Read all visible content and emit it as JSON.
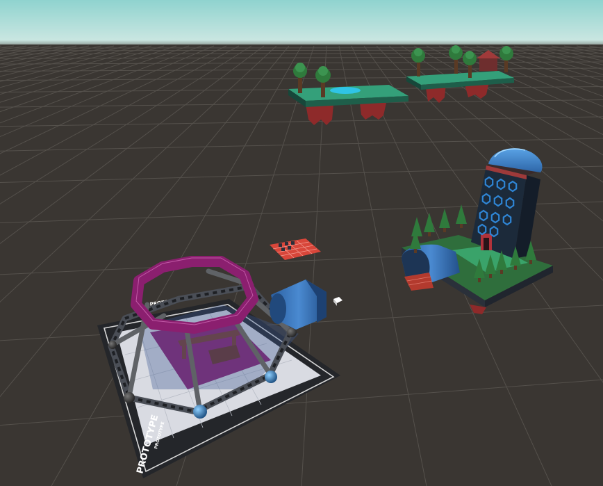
{
  "scene": {
    "base_labels": {
      "prototype_main": "PROTOTYPE",
      "prototype_small": "PROTOTYPE",
      "prototype_tiny": "PROTO"
    }
  },
  "colors": {
    "sky_top": "#8fd3cf",
    "sky_horizon": "#c9e6e1",
    "ground": "#3a3632",
    "grid_line": "#55514c",
    "octagon": "#8b1f6f",
    "leg": "#5f6266",
    "dome": "#3a7cc2",
    "tower": "#1c2a3a",
    "window_ring": "#2f86d6",
    "grass": "#2f6e3c",
    "island_top": "#34a07a",
    "tree": "#2f7a3c",
    "trunk": "#5a3a24",
    "tile_red": "#d8463a",
    "roots": "#8e2a2a"
  }
}
